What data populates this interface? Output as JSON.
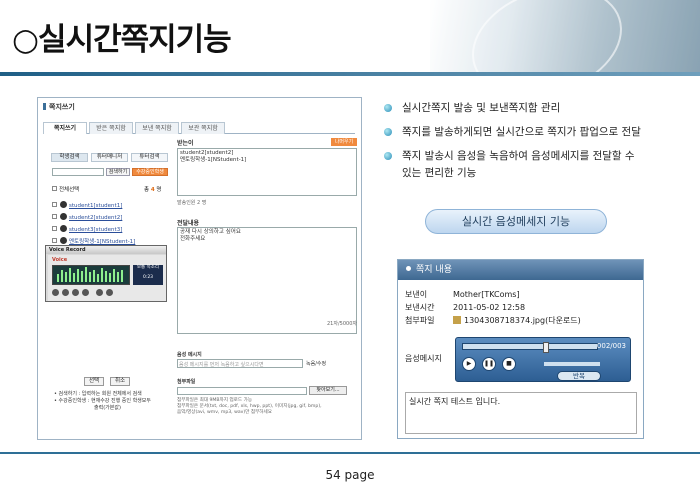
{
  "title": "○실시간쪽지기능",
  "page_label": "54 page",
  "app": {
    "window_title": "쪽지쓰기",
    "tabs": [
      "쪽지쓰기",
      "받은 쪽지함",
      "보낸 쪽지함",
      "보관 쪽지함"
    ],
    "subtabs": [
      "학생검색",
      "튜터매니저",
      "튜터검색"
    ],
    "search_btn": "검색하기",
    "course_btn": "수강중인학생",
    "select_all": "전체선택",
    "count_label": "총",
    "count_value": "4",
    "count_unit": "명",
    "students": [
      "student1[student1]",
      "student2[student2]",
      "student3[student3]",
      "멘토링학생-1[NStudent-1]"
    ],
    "select_btn": "선택",
    "cancel_btn": "취소",
    "notes": [
      "• 검색하기 : 입력하는 회원 전체에서 검색",
      "• 수강중인학생 : 현재수강 진행 중인 학생모두",
      "출력(가본값)"
    ],
    "recipient_label": "받는이",
    "addr_btn": "나머우기",
    "recipients": [
      "student2[student2]",
      "멘토링학생-1[NStudent-1]"
    ],
    "sent_count": "발송인원 2 명",
    "content_label": "전달내용",
    "content_lines": [
      "공재 다시 상의하고 싶어요",
      "전화주세요"
    ],
    "char_count": "21자/5000자",
    "voice_record": {
      "title": "Voice Record",
      "logo": "Voice",
      "side_label": "보통 목소리",
      "time": "0:23"
    },
    "voice_msg_label": "음성 메시지",
    "voice_placeholder": "음성 메시지를 먼저 녹음하고 싶으시다면",
    "voice_rec_btn": "녹음/수정",
    "attach_label": "첨부파일",
    "find_btn": "찾아보기...",
    "attach_notes": [
      "첨부파일은 최대 9MB까지 업로드 가능",
      "첨부파일은 문서(txt, doc, pdf, xls, hwp, ppt), 이미지(jpg, gif, bmp),",
      "음악/영상(avi, wmv, mp3, wav)만 첨부하세요"
    ]
  },
  "bullets": [
    "실시간쪽지 발송 및 보낸쪽지함 관리",
    "쪽지를 발송하게되면 실시간으로 쪽지가 팝업으로 전달",
    "쪽지 발송시 음성을 녹음하여 음성메세지를 전달할 수",
    "있는 편리한 기능"
  ],
  "pill_label": "실시간 음성메세지 기능",
  "popup": {
    "header": "쪽지 내용",
    "sender_label": "보낸이",
    "sender": "Mother[TKComs]",
    "time_label": "보낸시간",
    "time": "2011-05-02 12:58",
    "attach_label": "첨부파일",
    "attach": "1304308718374.jpg(다운로드)",
    "voice_label": "음성메시지",
    "player_time": "002/003",
    "back_btn": "반복",
    "body": "실시간 쪽지 테스트 입니다."
  }
}
